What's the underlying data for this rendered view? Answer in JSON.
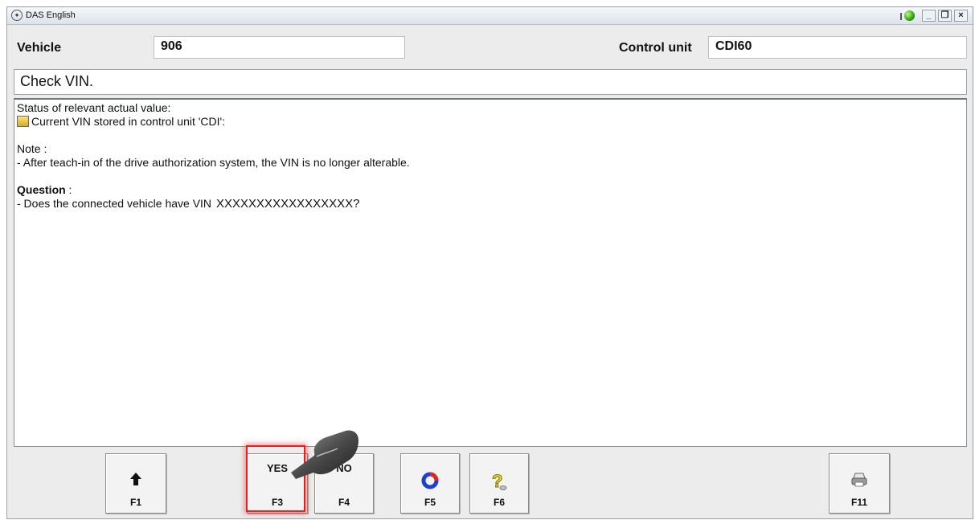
{
  "window": {
    "title": "DAS English"
  },
  "header": {
    "vehicle_label": "Vehicle",
    "vehicle_value": "906",
    "control_unit_label": "Control unit",
    "control_unit_value": "CDI60"
  },
  "step": {
    "title": "Check VIN."
  },
  "content": {
    "status_heading": "Status of relevant actual value:",
    "status_line": "Current VIN stored in control unit 'CDI':",
    "note_heading": "Note :",
    "note_line": "- After teach-in of the drive authorization system, the VIN is no longer alterable.",
    "question_heading": "Question",
    "question_colon": " :",
    "question_line": "- Does the connected vehicle have VIN",
    "vin_value": "XXXXXXXXXXXXXXXXX?"
  },
  "fkeys": [
    {
      "key": "F1",
      "icon": "up-arrow-icon",
      "caption": ""
    },
    {
      "key": "F3",
      "icon": "",
      "caption": "YES"
    },
    {
      "key": "F4",
      "icon": "",
      "caption": "NO"
    },
    {
      "key": "F5",
      "icon": "refresh-icon",
      "caption": ""
    },
    {
      "key": "F6",
      "icon": "help-icon",
      "caption": ""
    },
    {
      "key": "F11",
      "icon": "printer-icon",
      "caption": ""
    }
  ],
  "colors": {
    "highlight": "#e42020",
    "status_ok": "#2fa012"
  }
}
